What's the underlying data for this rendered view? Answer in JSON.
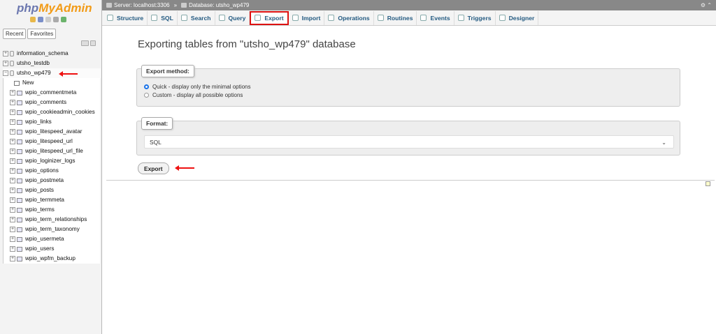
{
  "brand": {
    "php": "php",
    "my": "MyAdmin"
  },
  "nav": {
    "tabs": [
      "Recent",
      "Favorites"
    ],
    "tree": [
      {
        "label": "information_schema",
        "kind": "db"
      },
      {
        "label": "utsho_testdb",
        "kind": "db"
      },
      {
        "label": "utsho_wp479",
        "kind": "db",
        "selected": true
      },
      {
        "label": "New",
        "kind": "new"
      },
      {
        "label": "wpio_commentmeta",
        "kind": "table"
      },
      {
        "label": "wpio_comments",
        "kind": "table"
      },
      {
        "label": "wpio_cookieadmin_cookies",
        "kind": "table"
      },
      {
        "label": "wpio_links",
        "kind": "table"
      },
      {
        "label": "wpio_litespeed_avatar",
        "kind": "table"
      },
      {
        "label": "wpio_litespeed_url",
        "kind": "table"
      },
      {
        "label": "wpio_litespeed_url_file",
        "kind": "table"
      },
      {
        "label": "wpio_loginizer_logs",
        "kind": "table"
      },
      {
        "label": "wpio_options",
        "kind": "table"
      },
      {
        "label": "wpio_postmeta",
        "kind": "table"
      },
      {
        "label": "wpio_posts",
        "kind": "table"
      },
      {
        "label": "wpio_termmeta",
        "kind": "table"
      },
      {
        "label": "wpio_terms",
        "kind": "table"
      },
      {
        "label": "wpio_term_relationships",
        "kind": "table"
      },
      {
        "label": "wpio_term_taxonomy",
        "kind": "table"
      },
      {
        "label": "wpio_usermeta",
        "kind": "table"
      },
      {
        "label": "wpio_users",
        "kind": "table"
      },
      {
        "label": "wpio_wpfm_backup",
        "kind": "table"
      }
    ]
  },
  "breadcrumb": {
    "server": "Server: localhost:3306",
    "separator": "»",
    "database": "Database: utsho_wp479"
  },
  "menu": [
    {
      "label": "Structure",
      "icon": "structure-icon"
    },
    {
      "label": "SQL",
      "icon": "sql-icon"
    },
    {
      "label": "Search",
      "icon": "search-icon"
    },
    {
      "label": "Query",
      "icon": "query-icon"
    },
    {
      "label": "Export",
      "icon": "export-icon",
      "active": true
    },
    {
      "label": "Import",
      "icon": "import-icon"
    },
    {
      "label": "Operations",
      "icon": "operations-icon"
    },
    {
      "label": "Routines",
      "icon": "routines-icon"
    },
    {
      "label": "Events",
      "icon": "events-icon"
    },
    {
      "label": "Triggers",
      "icon": "triggers-icon"
    },
    {
      "label": "Designer",
      "icon": "designer-icon"
    }
  ],
  "page": {
    "title": "Exporting tables from \"utsho_wp479\" database",
    "export_method": {
      "legend": "Export method:",
      "quick": "Quick - display only the minimal options",
      "custom": "Custom - display all possible options",
      "selected": "quick"
    },
    "format": {
      "legend": "Format:",
      "value": "SQL"
    },
    "export_button": "Export"
  },
  "colors": {
    "accent": "#235a81",
    "highlight": "#dd1111",
    "topbar": "#888888"
  }
}
